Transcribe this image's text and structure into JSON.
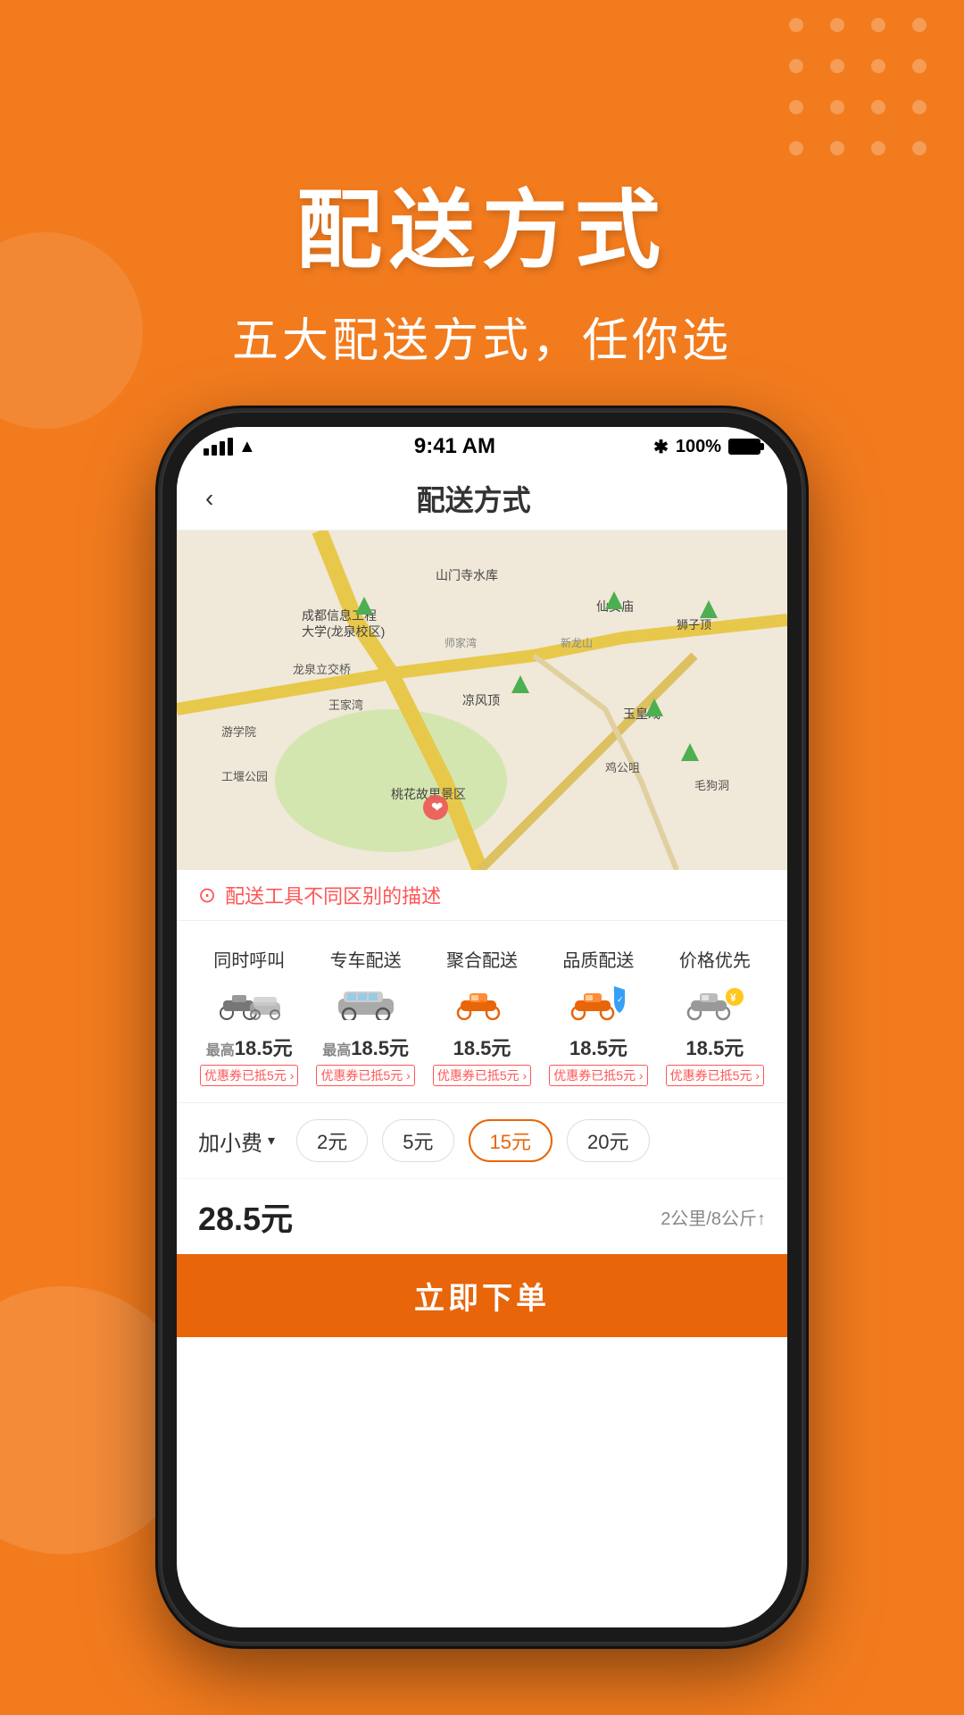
{
  "background_color": "#F27B1E",
  "hero": {
    "title": "配送方式",
    "subtitle": "五大配送方式，任你选"
  },
  "phone": {
    "status_bar": {
      "time": "9:41 AM",
      "battery_percent": "100%",
      "bluetooth": "✱"
    },
    "nav": {
      "back_icon": "‹",
      "title": "配送方式"
    },
    "warning_text": "配送工具不同区别的描述",
    "delivery_options": [
      {
        "name": "同时呼叫",
        "vehicle": "moto_car",
        "price": "最高18.5元",
        "has_prefix": true,
        "coupon": "优惠券已抵5元",
        "active": false
      },
      {
        "name": "专车配送",
        "vehicle": "car",
        "price": "最高18.5元",
        "has_prefix": true,
        "coupon": "优惠券已抵5元",
        "active": false
      },
      {
        "name": "聚合配送",
        "vehicle": "moto",
        "price": "18.5元",
        "has_prefix": false,
        "coupon": "优惠券已抵5元",
        "active": false
      },
      {
        "name": "品质配送",
        "vehicle": "moto_shield",
        "price": "18.5元",
        "has_prefix": false,
        "coupon": "优惠券已抵5元",
        "active": true
      },
      {
        "name": "价格优先",
        "vehicle": "moto_bag",
        "price": "18.5元",
        "has_prefix": false,
        "coupon": "优惠券已抵5元",
        "active": false
      }
    ],
    "extra_fee": {
      "label": "加小费",
      "options": [
        "2元",
        "5元",
        "15元",
        "20元"
      ],
      "selected": "15元"
    },
    "total_price": "28.5元",
    "delivery_info": "2公里/8公斤↑",
    "order_button": "立即下单"
  }
}
